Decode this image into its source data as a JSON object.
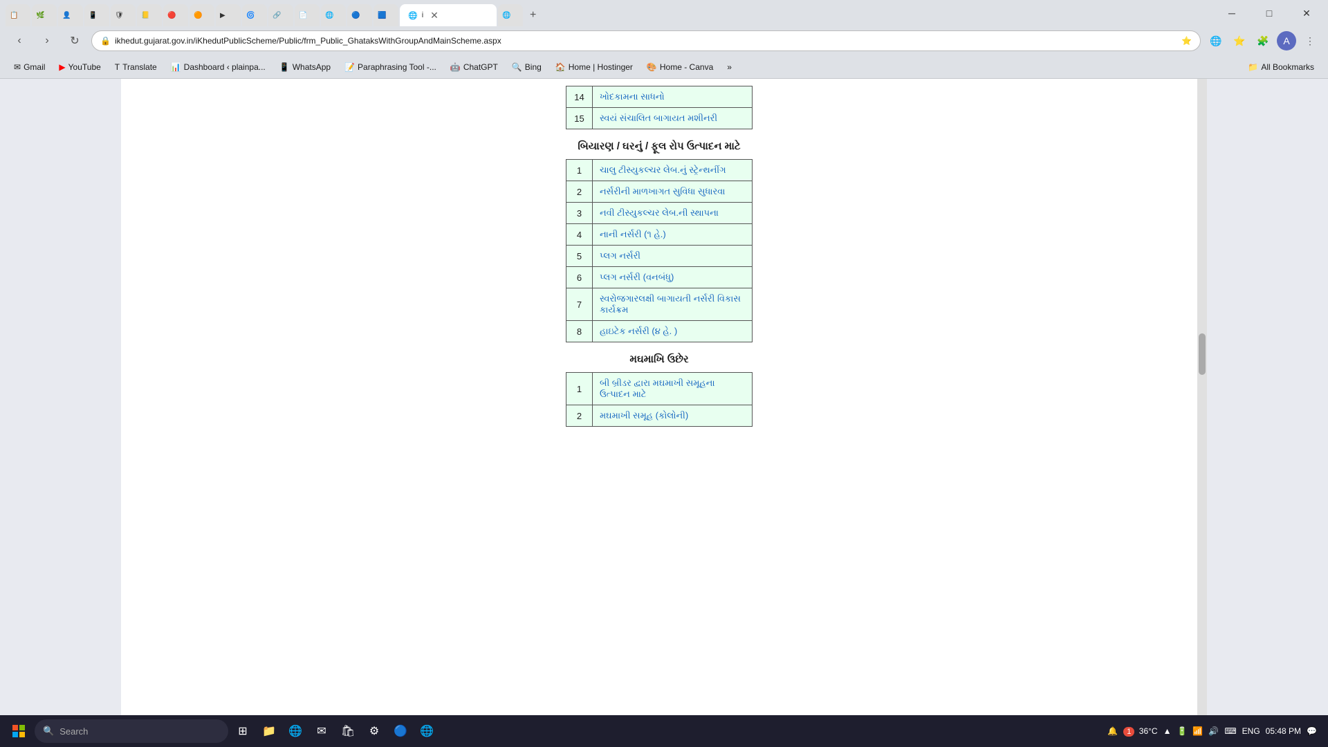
{
  "browser": {
    "url": "ikhedut.gujarat.gov.in/iKhedutPublicScheme/Public/frm_Public_GhataksWithGroupAndMainScheme.aspx",
    "tab_title": "i",
    "tab_favicon": "🌐"
  },
  "bookmarks": [
    {
      "label": "Gmail",
      "icon": "✉"
    },
    {
      "label": "YouTube",
      "icon": "▶"
    },
    {
      "label": "Translate",
      "icon": "T"
    },
    {
      "label": "Dashboard ‹ plainpa...",
      "icon": "📊"
    },
    {
      "label": "WhatsApp",
      "icon": "📱"
    },
    {
      "label": "Paraphrasing Tool -...",
      "icon": "📝"
    },
    {
      "label": "ChatGPT",
      "icon": "🤖"
    },
    {
      "label": "Bing",
      "icon": "🔍"
    },
    {
      "label": "Home | Hostinger",
      "icon": "🏠"
    },
    {
      "label": "Home - Canva",
      "icon": "🎨"
    },
    {
      "label": "All Bookmarks",
      "icon": "📁"
    }
  ],
  "page": {
    "table1": {
      "rows": [
        {
          "num": "14",
          "text": "ખોદકામના સાધનો"
        },
        {
          "num": "15",
          "text": "સ્વયં સંચાલિત બાગાયત મશીનરી"
        }
      ]
    },
    "section2_heading": "બિયારણ / ઘરનું / ફૂલ રોપ ઉત્પાદન માટે",
    "table2": {
      "rows": [
        {
          "num": "1",
          "text": "ચાલુ ટીસ્યુકલ્ચર લેબ.નું સ્ટ્રેન્થનીંગ"
        },
        {
          "num": "2",
          "text": "નર્સરીની માળખાગત સુવિધા સુધારવા"
        },
        {
          "num": "3",
          "text": "નવી ટીસ્યુકલ્ચર લેબ.ની સ્થાપના"
        },
        {
          "num": "4",
          "text": "નાની નર્સરી (૧ હે.)"
        },
        {
          "num": "5",
          "text": "પ્લગ નર્સરી"
        },
        {
          "num": "6",
          "text": "પ્લગ નર્સરી (વનબંધુ)"
        },
        {
          "num": "7",
          "text": "સ્વરોજગારલક્ષી બાગાયતી નર્સરી વિકાસ કાર્યક્રમ"
        },
        {
          "num": "8",
          "text": "હાઇટેક નર્સરી (૪ હે. )"
        }
      ]
    },
    "section3_heading": "મઘમાખિ ઉછેર",
    "table3": {
      "rows": [
        {
          "num": "1",
          "text": "બી બ્રીડર દ્વારા મઘમાખી સમૂહના ઉત્પાદન માટે"
        },
        {
          "num": "2",
          "text": "મઘમાખી સમૂહ (કોલોની)"
        }
      ]
    }
  },
  "taskbar": {
    "search_placeholder": "Search",
    "time": "05:48 PM",
    "lang": "ENG",
    "temp": "36°C"
  }
}
